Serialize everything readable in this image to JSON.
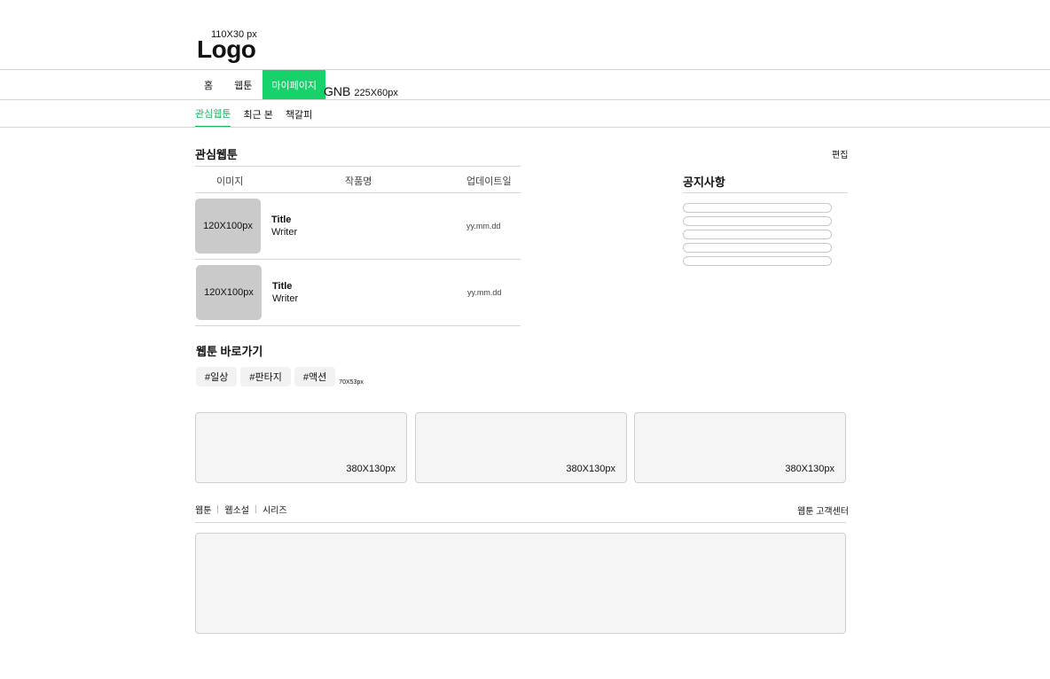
{
  "header": {
    "logo_size_note": "110X30 px",
    "logo_text": "Logo"
  },
  "gnb": {
    "items": [
      {
        "label": "홈"
      },
      {
        "label": "웹툰"
      },
      {
        "label": "마이페이지"
      }
    ],
    "label": "GNB",
    "size_note": "225X60px",
    "accent_color": "#17d16b"
  },
  "subtabs": {
    "items": [
      {
        "label": "관심웹툰"
      },
      {
        "label": "최근 본"
      },
      {
        "label": "책갈피"
      }
    ],
    "active_color": "#17b85c"
  },
  "interest": {
    "title": "관심웹툰",
    "edit_label": "편집",
    "columns": {
      "image": "이미지",
      "name": "작품명",
      "updated": "업데이트일"
    },
    "rows": [
      {
        "thumb": "120X100px",
        "title": "Title",
        "writer": "Writer",
        "date": "yy.mm.dd"
      },
      {
        "thumb": "120X100px",
        "title": "Title",
        "writer": "Writer",
        "date": "yy.mm.dd"
      }
    ]
  },
  "notice": {
    "title": "공지사항",
    "item_count_visible": 5
  },
  "shortcut": {
    "title": "웹툰 바로가기",
    "tags": [
      {
        "label": "#일상"
      },
      {
        "label": "#판타지"
      },
      {
        "label": "#액션"
      }
    ],
    "tag_size_note": "70X53px"
  },
  "banners": [
    {
      "label": "380X130px"
    },
    {
      "label": "380X130px"
    },
    {
      "label": "380X130px"
    }
  ],
  "footer": {
    "tabs": [
      {
        "label": "웹툰"
      },
      {
        "label": "웹소설"
      },
      {
        "label": "시리즈"
      }
    ],
    "cs_label": "웹툰 고객센터"
  }
}
